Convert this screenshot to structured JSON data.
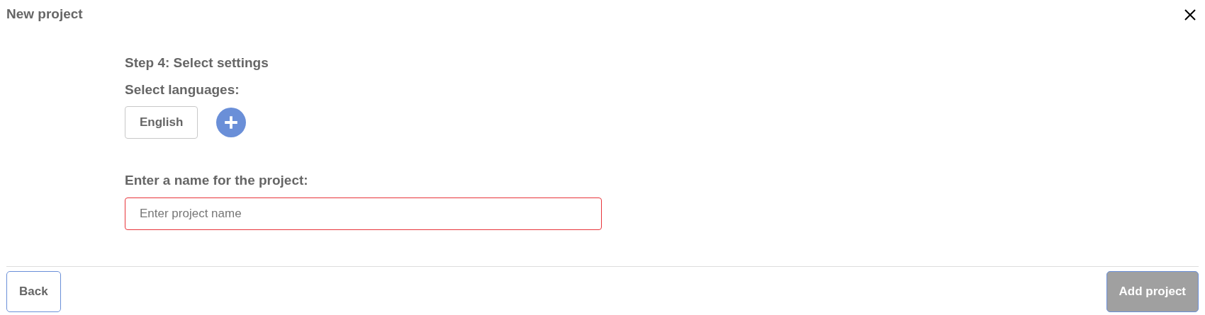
{
  "dialog": {
    "title": "New project"
  },
  "step": {
    "heading": "Step 4: Select settings",
    "languages_label": "Select languages:",
    "languages": [
      "English"
    ],
    "name_label": "Enter a name for the project:",
    "name_field": {
      "placeholder": "Enter project name",
      "invalid": true
    }
  },
  "footer": {
    "back": {
      "label": "Back",
      "disabled": false
    },
    "submit": {
      "label": "Add project",
      "disabled": true
    }
  }
}
